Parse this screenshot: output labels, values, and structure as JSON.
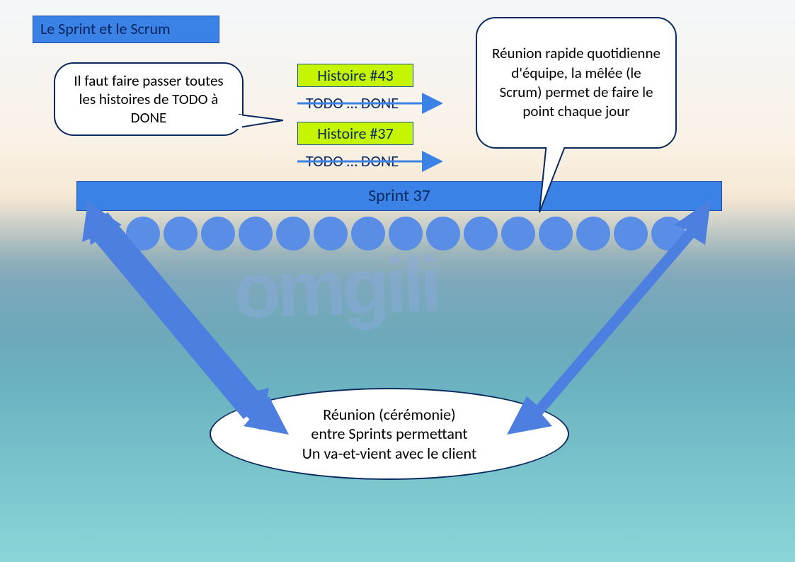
{
  "title": "Le Sprint et le Scrum",
  "bubble_left": "Il faut faire passer toutes les histoires de TODO à DONE",
  "bubble_right": "Réunion rapide quotidienne d'équipe, la mêlée (le Scrum) permet de faire le point chaque jour",
  "stories": {
    "s43": "Histoire #43",
    "s37": "Histoire #37"
  },
  "todo_done": "TODO … DONE",
  "sprint_bar": "Sprint 37",
  "bottom_ellipse_line1": "Réunion (cérémonie)",
  "bottom_ellipse_line2": "entre Sprints permettant",
  "bottom_ellipse_line3": "Un va-et-vient avec le client",
  "dot_count": 15,
  "watermark": "omgili",
  "colors": {
    "primary_blue": "#3b82e6",
    "dark_blue": "#1e4da8",
    "text_navy": "#0a2a5f",
    "histoire_bg": "#c6f500",
    "dot_blue": "#5a8ee6"
  }
}
